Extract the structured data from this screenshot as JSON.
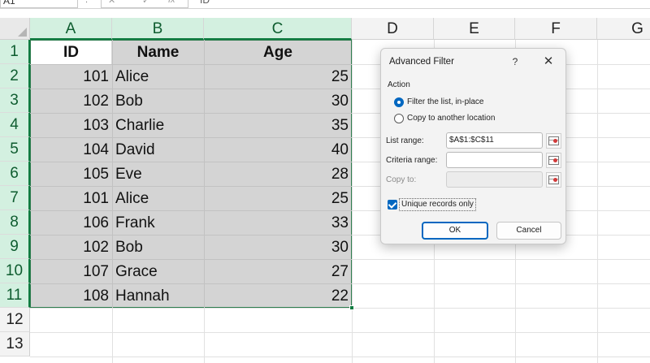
{
  "formula_bar": {
    "name_box": "A1",
    "separator": ":",
    "cancel_glyph": "✕",
    "enter_glyph": "✓",
    "fx_label": "fx",
    "content": "ID"
  },
  "sheet": {
    "columns": [
      "A",
      "B",
      "C",
      "D",
      "E",
      "F",
      "G"
    ],
    "rows": [
      "1",
      "2",
      "3",
      "4",
      "5",
      "6",
      "7",
      "8",
      "9",
      "10",
      "11",
      "12",
      "13"
    ],
    "header": {
      "id": "ID",
      "name": "Name",
      "age": "Age"
    },
    "records": [
      {
        "id": "101",
        "name": "Alice",
        "age": "25"
      },
      {
        "id": "102",
        "name": "Bob",
        "age": "30"
      },
      {
        "id": "103",
        "name": "Charlie",
        "age": "35"
      },
      {
        "id": "104",
        "name": "David",
        "age": "40"
      },
      {
        "id": "105",
        "name": "Eve",
        "age": "28"
      },
      {
        "id": "101",
        "name": "Alice",
        "age": "25"
      },
      {
        "id": "106",
        "name": "Frank",
        "age": "33"
      },
      {
        "id": "102",
        "name": "Bob",
        "age": "30"
      },
      {
        "id": "107",
        "name": "Grace",
        "age": "27"
      },
      {
        "id": "108",
        "name": "Hannah",
        "age": "22"
      }
    ],
    "selected_range": "A1:C11",
    "accent_color": "#107c41"
  },
  "dialog": {
    "title": "Advanced Filter",
    "help": "?",
    "close": "✕",
    "action_label": "Action",
    "option_filter": "Filter the list, in-place",
    "option_copy": "Copy to another location",
    "selected_option": "filter",
    "list_range_label": "List range:",
    "list_range_value": "$A$1:$C$11",
    "criteria_range_label": "Criteria range:",
    "criteria_range_value": "",
    "copy_to_label": "Copy to:",
    "copy_to_value": "",
    "unique_label": "Unique records only",
    "unique_checked": true,
    "ok_label": "OK",
    "cancel_label": "Cancel",
    "primary_color": "#0067c0"
  }
}
